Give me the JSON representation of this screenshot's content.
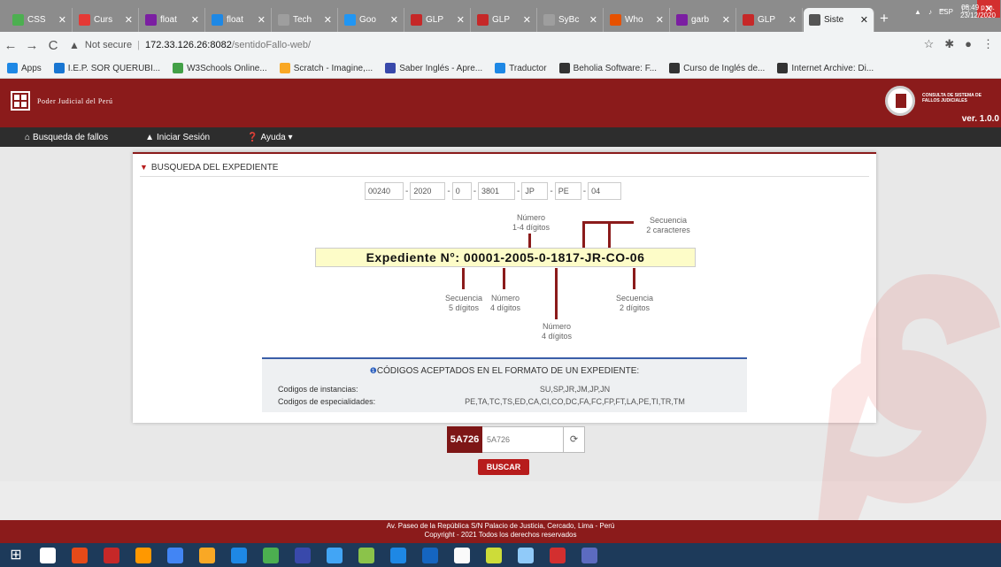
{
  "browser": {
    "tabs": [
      {
        "label": "CSS",
        "color": "#4caf50"
      },
      {
        "label": "Curs",
        "color": "#e53935"
      },
      {
        "label": "float",
        "color": "#7b1fa2"
      },
      {
        "label": "float",
        "color": "#1e88e5"
      },
      {
        "label": "Tech",
        "color": "#9e9e9e"
      },
      {
        "label": "Goo",
        "color": "#2196f3"
      },
      {
        "label": "GLP",
        "color": "#c62828"
      },
      {
        "label": "GLP",
        "color": "#c62828"
      },
      {
        "label": "SyBc",
        "color": "#9e9e9e"
      },
      {
        "label": "Who",
        "color": "#e65100"
      },
      {
        "label": "garb",
        "color": "#7b1fa2"
      },
      {
        "label": "GLP",
        "color": "#c62828"
      },
      {
        "label": "Siste",
        "color": "#555555",
        "active": true
      }
    ],
    "new_tab": "+",
    "window": {
      "minimize": "‒",
      "maximize": "□",
      "close": "✕"
    },
    "address": {
      "security": "Not secure",
      "host": "172.33.126.26:8082",
      "path": "/sentidoFallo-web/"
    },
    "bookmarks": [
      {
        "label": "Apps",
        "color": "#1e88e5"
      },
      {
        "label": "I.E.P. SOR QUERUBI...",
        "color": "#1976d2"
      },
      {
        "label": "W3Schools Online...",
        "color": "#43a047"
      },
      {
        "label": "Scratch - Imagine,...",
        "color": "#f9a825"
      },
      {
        "label": "Saber Inglés - Apre...",
        "color": "#3949ab"
      },
      {
        "label": "Traductor",
        "color": "#1e88e5"
      },
      {
        "label": "Beholia Software: F...",
        "color": "#333333"
      },
      {
        "label": "Curso de Inglés de...",
        "color": "#333333"
      },
      {
        "label": "Internet Archive: Di...",
        "color": "#333333"
      }
    ]
  },
  "site": {
    "org_name": "Poder Judicial del Perú",
    "system_name": "CONSULTA DE SISTEMA DE FALLOS JUDICIALES",
    "version": "ver. 1.0.0",
    "nav": [
      {
        "icon": "home",
        "label": "Busqueda de fallos"
      },
      {
        "icon": "user",
        "label": "Iniciar Sesión"
      },
      {
        "icon": "help",
        "label": "Ayuda ▾"
      }
    ]
  },
  "search": {
    "section_title": "BUSQUEDA DEL EXPEDIENTE",
    "fields": [
      "00240",
      "2020",
      "0",
      "3801",
      "JP",
      "PE",
      "04"
    ],
    "example": "Expediente N°: 00001-2005-0-1817-JR-CO-06",
    "annotations": {
      "num_top": [
        "Número",
        "1-4 dígitos"
      ],
      "seq_top": [
        "Secuencia",
        "2 caracteres"
      ],
      "seq5": [
        "Secuencia",
        "5 dígitos"
      ],
      "num4a": [
        "Número",
        "4 dígitos"
      ],
      "num4b": [
        "Número",
        "4 dígitos"
      ],
      "seq2": [
        "Secuencia",
        "2 dígitos"
      ]
    }
  },
  "codes": {
    "title": "CÓDIGOS ACEPTADOS EN EL FORMATO DE UN EXPEDIENTE:",
    "rows": [
      {
        "label": "Codigos de instancias:",
        "value": "SU,SP,JR,JM,JP,JN"
      },
      {
        "label": "Codigos de especialidades:",
        "value": "PE,TA,TC,TS,ED,CA,CI,CO,DC,FA,FC,FP,FT,LA,PE,TI,TR,TM"
      }
    ]
  },
  "captcha": {
    "image_text": "5A726",
    "input_value": "5A726",
    "refresh": "⟳",
    "button": "BUSCAR"
  },
  "footer": {
    "line1": "Av. Paseo de la República S/N Palacio de Justicia, Cercado, Lima - Perú",
    "line2": "Copyright - 2021 Todos los derechos reservados"
  },
  "taskbar": {
    "apps": [
      "#ffffff",
      "#e64a19",
      "#c62828",
      "#ff9800",
      "#4285f4",
      "#f9a825",
      "#1e88e5",
      "#4caf50",
      "#3949ab",
      "#42a5f5",
      "#8bc34a",
      "#1e88e5",
      "#1565c0",
      "#fafafa",
      "#cddc39",
      "#90caf9",
      "#d32f2f",
      "#5c6bc0"
    ],
    "lang": "ESP",
    "time": "08:49 p.m.",
    "date": "23/12/2020"
  },
  "colors": {
    "brand": "#8b1b1b",
    "accent_red": "#b71c1c",
    "navbar": "#2d2d2d"
  }
}
